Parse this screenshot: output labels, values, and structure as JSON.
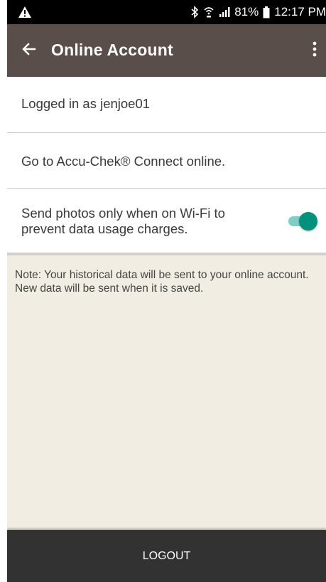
{
  "status_bar": {
    "battery": "81%",
    "time": "12:17 PM"
  },
  "app_bar": {
    "title": "Online Account"
  },
  "rows": [
    {
      "label": "Logged in as jenjoe01"
    },
    {
      "label": "Go to Accu-Chek® Connect online."
    },
    {
      "label_line1": "Send photos only when on Wi-Fi to",
      "label_line2": "prevent data usage charges.",
      "toggle_on": true
    }
  ],
  "note": {
    "text": "Note: Your historical data will be sent to your online account. New data will be sent when it is saved."
  },
  "footer": {
    "logout_label": "LOGOUT"
  },
  "colors": {
    "app_bar": "#5a4e4a",
    "accent_teal": "#00927c",
    "note_background": "#f2ede3",
    "footer": "#323232"
  },
  "icons": {
    "status_warning": "warning-icon",
    "bluetooth": "bluetooth-icon",
    "wifi_calling": "wifi-calling-icon",
    "signal": "signal-icon",
    "battery": "battery-icon",
    "back": "back-arrow-icon",
    "overflow": "more-vert-icon"
  }
}
